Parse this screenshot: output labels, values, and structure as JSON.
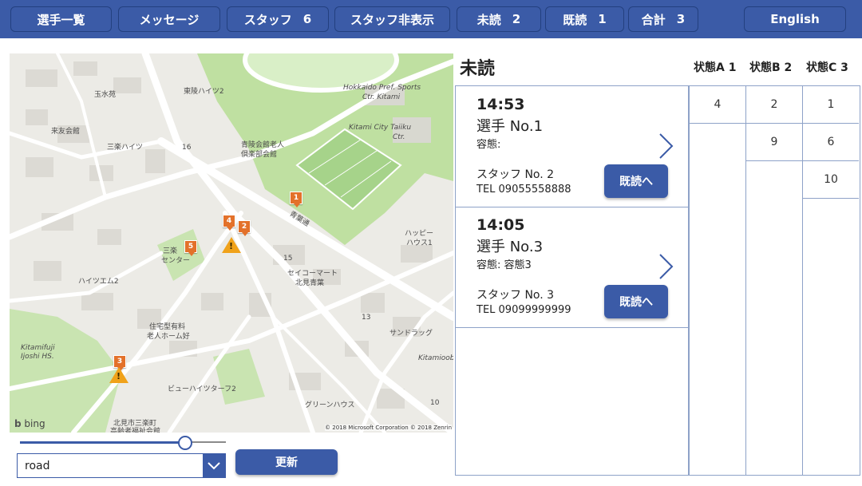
{
  "nav": {
    "players": "選手一覧",
    "messages": "メッセージ",
    "staff_label": "スタッフ",
    "staff_count": "6",
    "staff_hide": "スタッフ非表示",
    "unread_label": "未読",
    "unread_count": "2",
    "read_label": "既読",
    "read_count": "1",
    "total_label": "合計",
    "total_count": "3",
    "language": "English"
  },
  "map": {
    "labels": {
      "kitami_sports": "Hokkaido Pref. Sports",
      "kitami_sports2": "Ctr. Kitami",
      "taiiku": "Kitami City Taiiku",
      "taiiku2": "Ctr.",
      "tamamizu": "玉水苑",
      "touryo": "東陵ハイツ2",
      "raiyu": "来友会館",
      "sanraku": "三楽ハイツ",
      "seiryo1": "青陵会館老人",
      "seiryo2": "倶楽部会館",
      "aoba": "青葉通",
      "happy1": "ハッピー",
      "happy2": "ハウス1",
      "sanraku_c1": "三楽",
      "sanraku_c2": "センター",
      "seicomart1": "セイコーマート",
      "seicomart2": "北見青葉",
      "heights_m": "ハイツエム2",
      "jutaku1": "住宅型有料",
      "jutaku2": "老人ホーム好",
      "sundrug": "サンドラッグ",
      "kitamifuji1": "Kitamifuji",
      "kitamifuji2": "Ijoshi HS.",
      "kitamioob": "Kitamioob",
      "view": "ビューハイツターフ2",
      "green": "グリーンハウス",
      "kitami_sanraku1": "北見市三楽町",
      "kitami_sanraku2": "高齢者福祉会館",
      "n16": "16",
      "n15": "15",
      "n13": "13",
      "n10": "10",
      "bing": "bing",
      "copyright": "© 2018 Microsoft Corporation © 2018 Zenrin"
    },
    "pins": [
      "1",
      "4",
      "2",
      "5",
      "3"
    ],
    "warn_mark": "!",
    "type_value": "road",
    "update_label": "更新",
    "zoom_fraction": 0.8
  },
  "list": {
    "title": "未読",
    "items": [
      {
        "time": "14:53",
        "player": "選手 No.1",
        "condition": "容態:",
        "staff": "スタッフ No. 2",
        "tel": "TEL 09055558888",
        "button": "既読へ"
      },
      {
        "time": "14:05",
        "player": "選手 No.3",
        "condition": "容態: 容態3",
        "staff": "スタッフ No. 3",
        "tel": "TEL 09099999999",
        "button": "既読へ"
      }
    ]
  },
  "states": {
    "a": {
      "label": "状態A",
      "count": "1",
      "values": [
        "4"
      ]
    },
    "b": {
      "label": "状態B",
      "count": "2",
      "values": [
        "2",
        "9"
      ]
    },
    "c": {
      "label": "状態C",
      "count": "3",
      "values": [
        "1",
        "6",
        "10"
      ]
    }
  },
  "colors": {
    "accent": "#3b5ba7",
    "pin": "#e3712a",
    "warning": "#f0a21a",
    "park": "#bfe0a1"
  }
}
